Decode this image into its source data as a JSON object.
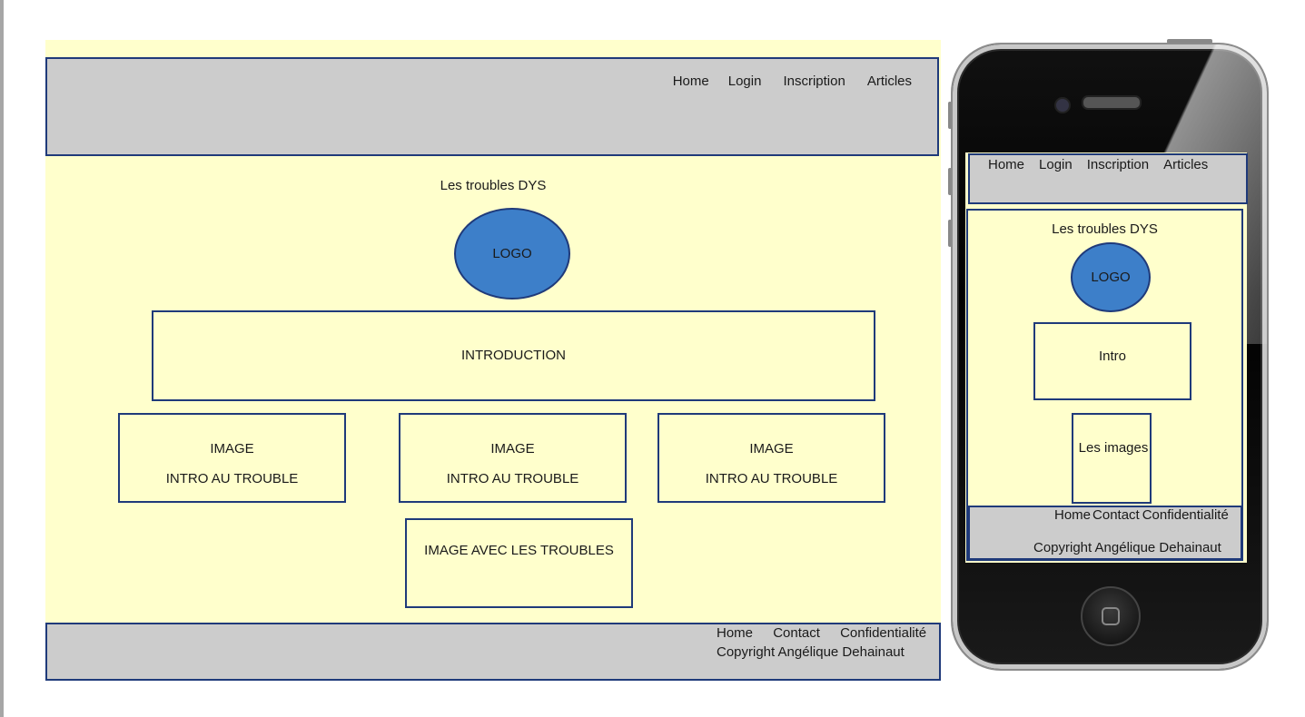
{
  "desktop": {
    "nav": [
      "Home",
      "Login",
      "Inscription",
      "Articles"
    ],
    "heading": "Les troubles DYS",
    "logo": "LOGO",
    "introduction": "INTRODUCTION",
    "cards": [
      {
        "image": "IMAGE",
        "text": "INTRO AU TROUBLE"
      },
      {
        "image": "IMAGE",
        "text": "INTRO AU TROUBLE"
      },
      {
        "image": "IMAGE",
        "text": "INTRO AU TROUBLE"
      }
    ],
    "image_troubles": "IMAGE AVEC LES TROUBLES",
    "footer": {
      "links": [
        "Home",
        "Contact",
        "Confidentialité"
      ],
      "copyright": "Copyright Angélique Dehainaut"
    }
  },
  "mobile": {
    "nav": [
      "Home",
      "Login",
      "Inscription",
      "Articles"
    ],
    "heading": "Les troubles DYS",
    "logo": "LOGO",
    "intro": "Intro",
    "images": "Les images",
    "footer": {
      "links": [
        "Home",
        "Contact",
        "Confidentialité"
      ],
      "copyright": "Copyright Angélique Dehainaut"
    }
  },
  "colors": {
    "page_bg": "#ffffcc",
    "bar_bg": "#cccccc",
    "border": "#1f3a7a",
    "logo": "#3d7fc9"
  }
}
